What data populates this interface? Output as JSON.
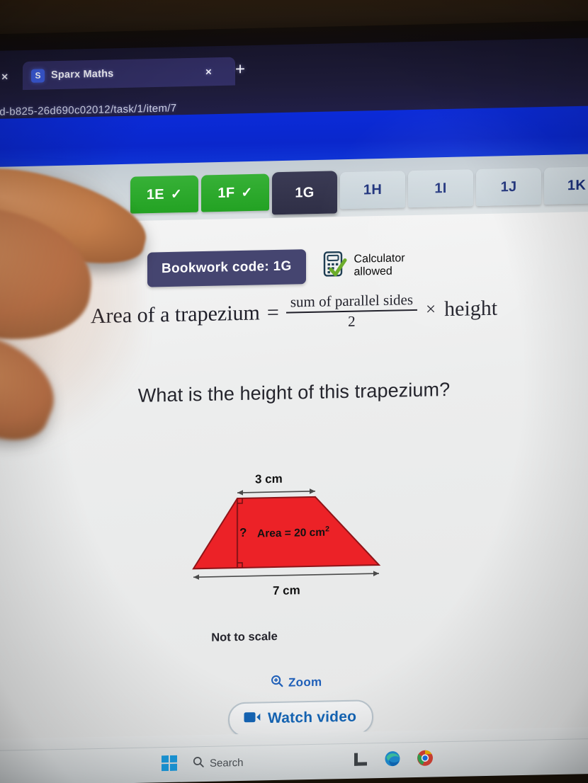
{
  "browser": {
    "tab_title": "Sparx Maths",
    "favicon_letter": "S",
    "tab_close_left": "×",
    "tab_close": "×",
    "new_tab": "+",
    "url": "6ed-b825-26d690c02012/task/1/item/7"
  },
  "exercise_tabs": [
    {
      "label": "1E",
      "state": "done",
      "check": "✓"
    },
    {
      "label": "1F",
      "state": "done",
      "check": "✓"
    },
    {
      "label": "1G",
      "state": "active",
      "check": ""
    },
    {
      "label": "1H",
      "state": "todo",
      "check": ""
    },
    {
      "label": "1I",
      "state": "todo",
      "check": ""
    },
    {
      "label": "1J",
      "state": "todo",
      "check": ""
    },
    {
      "label": "1K",
      "state": "todo",
      "check": ""
    }
  ],
  "question": {
    "bookwork_code": "Bookwork code: 1G",
    "calculator_line1": "Calculator",
    "calculator_line2": "allowed",
    "formula": {
      "lhs": "Area of a trapezium",
      "equals": "=",
      "numerator": "sum of parallel sides",
      "denominator": "2",
      "times": "×",
      "rhs": "height"
    },
    "prompt": "What is the height of this trapezium?",
    "not_to_scale": "Not to scale",
    "zoom_label": "Zoom",
    "watch_video_label": "Watch video"
  },
  "figure": {
    "type": "trapezium",
    "top_side": "3 cm",
    "bottom_side": "7 cm",
    "area_label": "Area = 20 cm",
    "area_superscript": "2",
    "height_label": "?",
    "fill_color": "#ec2227",
    "stroke_color": "#8f1418"
  },
  "taskbar": {
    "search_label": "Search"
  },
  "colors": {
    "tab_done": "#23a223",
    "tab_active": "#333349",
    "tab_todo": "#ccd6db",
    "bookwork_badge": "#454570",
    "link_blue": "#1f5fb8",
    "band_blue": "#0a27cc"
  }
}
